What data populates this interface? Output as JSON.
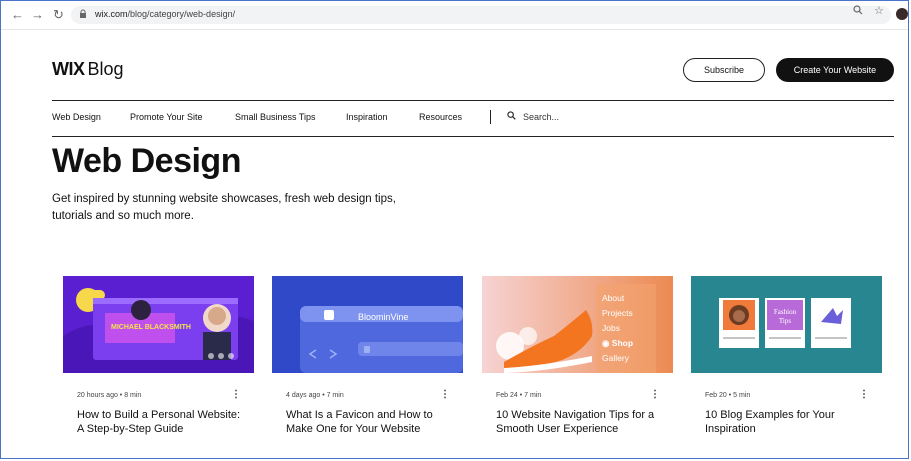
{
  "browser": {
    "back": "←",
    "forward": "→",
    "reload": "↻",
    "url_domain": "wix.com",
    "url_path": "/blog/category/web-design/"
  },
  "header": {
    "brand_wix": "WIX",
    "brand_blog": "Blog",
    "subscribe": "Subscribe",
    "create": "Create Your Website"
  },
  "nav": {
    "items": [
      "Web Design",
      "Promote Your Site",
      "Small Business Tips",
      "Inspiration",
      "Resources"
    ],
    "search": "Search..."
  },
  "page": {
    "title": "Web Design",
    "description": "Get inspired by stunning website showcases, fresh web design tips, tutorials and so much more."
  },
  "posts": [
    {
      "meta": "20 hours ago  •  8 min",
      "title": "How to Build a Personal Website: A Step-by-Step Guide",
      "thumb_text": "MICHAEL BLACKSMITH"
    },
    {
      "meta": "4 days ago  •  7 min",
      "title": "What Is a Favicon and How to Make One for Your Website",
      "thumb_text": "BloominVine"
    },
    {
      "meta": "Feb 24  •  7 min",
      "title": "10 Website Navigation Tips for a Smooth User Experience",
      "thumb_menu": [
        "About",
        "Projects",
        "Jobs",
        "Shop",
        "Gallery"
      ]
    },
    {
      "meta": "Feb 20  •  5 min",
      "title": "10 Blog Examples for Your Inspiration",
      "thumb_text": "Fashion Tips"
    }
  ],
  "colors": {
    "accent_dark": "#111111",
    "card1_bg": "#5a1fd1",
    "card2_bg": "#2f49c8",
    "card3_bg": "#ec8a52",
    "card4_bg": "#27868f"
  }
}
